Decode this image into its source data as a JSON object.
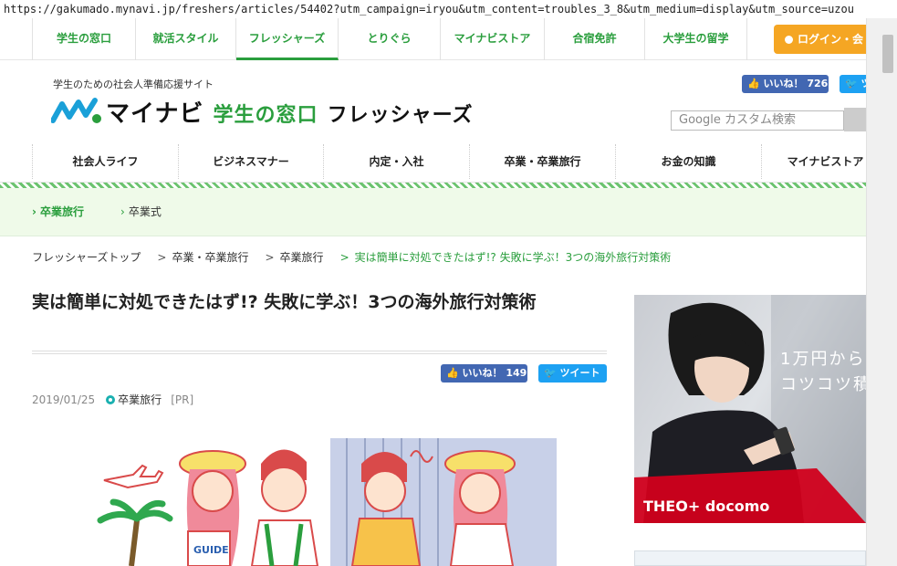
{
  "url": "https://gakumado.mynavi.jp/freshers/articles/54402?utm_campaign=iryou&utm_content=troubles_3_8&utm_medium=display&utm_source=uzou",
  "topnav": {
    "items": [
      "学生の窓口",
      "就活スタイル",
      "フレッシャーズ",
      "とりぐら",
      "マイナビストア",
      "合宿免許",
      "大学生の留学"
    ],
    "login": "ログイン・会"
  },
  "header": {
    "tagline": "学生のための社会人準備応援サイト",
    "logo_main": "マイナビ",
    "logo_green": "学生の窓口",
    "logo_sub": "フレッシャーズ",
    "fb_like_top": "いいね！ 726",
    "tweet_top": "ツ",
    "search_placeholder": "Google カスタム検索"
  },
  "mainnav": {
    "items": [
      "社会人ライフ",
      "ビジネスマナー",
      "内定・入社",
      "卒業・卒業旅行",
      "お金の知識",
      "マイナビストア"
    ]
  },
  "subnav": {
    "items": [
      "卒業旅行",
      "卒業式"
    ]
  },
  "breadcrumb": {
    "items": [
      "フレッシャーズトップ",
      "卒業・卒業旅行",
      "卒業旅行",
      "実は簡単に対処できたはず!? 失敗に学ぶ！3つの海外旅行対策術"
    ],
    "sep": ">"
  },
  "article": {
    "title": "実は簡単に対処できたはず!? 失敗に学ぶ！3つの海外旅行対策術",
    "fb_like": "いいね！ 149",
    "tweet": "ツイート",
    "date": "2019/01/25",
    "category": "卒業旅行",
    "pr": "[PR]"
  },
  "ad": {
    "line1": "1万円から",
    "line2": "コツコツ積",
    "brand": "THEO+ docomo"
  },
  "colors": {
    "brand_green": "#2a9e3d",
    "login_orange": "#f5a623",
    "facebook": "#4267b2",
    "twitter": "#1da1f2"
  }
}
